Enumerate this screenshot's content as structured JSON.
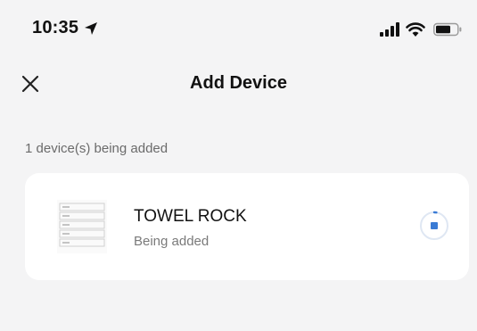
{
  "status_bar": {
    "time": "10:35",
    "icons": [
      "location-arrow-icon",
      "cellular-signal-icon",
      "wifi-icon",
      "battery-icon"
    ]
  },
  "header": {
    "title": "Add Device",
    "close_icon": "close-icon"
  },
  "main": {
    "section_label": "1 device(s) being added",
    "devices": [
      {
        "name": "TOWEL ROCK",
        "status": "Being added",
        "thumbnail_icon": "device-thumbnail-icon",
        "action_icon": "stop-progress-icon"
      }
    ]
  },
  "colors": {
    "background": "#f4f4f5",
    "card": "#ffffff",
    "accent": "#3a7bd5",
    "text_primary": "#111111",
    "text_secondary": "#7a7a7a"
  }
}
